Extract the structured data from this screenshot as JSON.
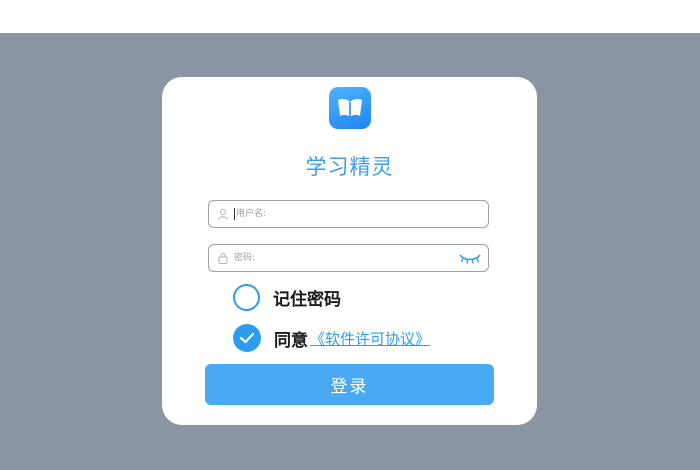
{
  "app": {
    "title": "学习精灵",
    "logo_icon": "book-icon",
    "accent_color": "#2d9cf0"
  },
  "form": {
    "username": {
      "placeholder": "用户名:",
      "value": "",
      "icon": "user-icon"
    },
    "password": {
      "placeholder": "密码:",
      "value": "",
      "icon": "lock-icon",
      "toggle_icon": "eye-closed-icon"
    },
    "remember": {
      "label": "记住密码",
      "checked": false
    },
    "agreement": {
      "prefix": "同意",
      "link_text": "《软件许可协议》",
      "checked": true
    },
    "submit_label": "登录"
  }
}
